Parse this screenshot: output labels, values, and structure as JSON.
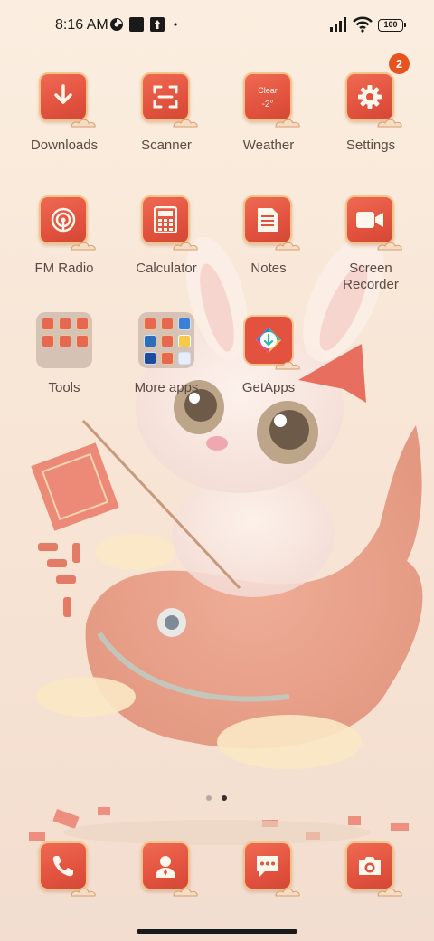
{
  "status_bar": {
    "time": "8:16 AM",
    "battery": "100",
    "icons": [
      "data-saver-icon",
      "square-notification-icon",
      "upload-arrow-icon",
      "dot-icon",
      "signal-icon",
      "wifi-icon",
      "battery-icon"
    ]
  },
  "apps": [
    {
      "label": "Downloads",
      "icon": "download-arrow-icon"
    },
    {
      "label": "Scanner",
      "icon": "scan-frame-icon"
    },
    {
      "label": "Weather",
      "icon": "weather-icon",
      "weather_condition": "Clear",
      "weather_temp": "-2°"
    },
    {
      "label": "Settings",
      "icon": "gear-icon",
      "badge": "2"
    },
    {
      "label": "FM Radio",
      "icon": "radio-wave-icon"
    },
    {
      "label": "Calculator",
      "icon": "calculator-icon"
    },
    {
      "label": "Notes",
      "icon": "notes-icon"
    },
    {
      "label": "Screen\nRecorder",
      "label_line1": "Screen",
      "label_line2": "Recorder",
      "icon": "video-camera-icon"
    },
    {
      "label": "Tools",
      "icon": "folder-icon"
    },
    {
      "label": "More apps",
      "icon": "folder-icon"
    },
    {
      "label": "GetApps",
      "icon": "getapps-icon"
    }
  ],
  "page_indicator": {
    "pages": 2,
    "current": 2
  },
  "dock": [
    {
      "icon": "phone-icon"
    },
    {
      "icon": "contacts-icon"
    },
    {
      "icon": "messages-icon"
    },
    {
      "icon": "camera-icon"
    }
  ],
  "colors": {
    "icon_red": "#e2523f",
    "icon_border": "#f4c48a",
    "badge": "#e8521f",
    "label": "#5a4a44"
  }
}
